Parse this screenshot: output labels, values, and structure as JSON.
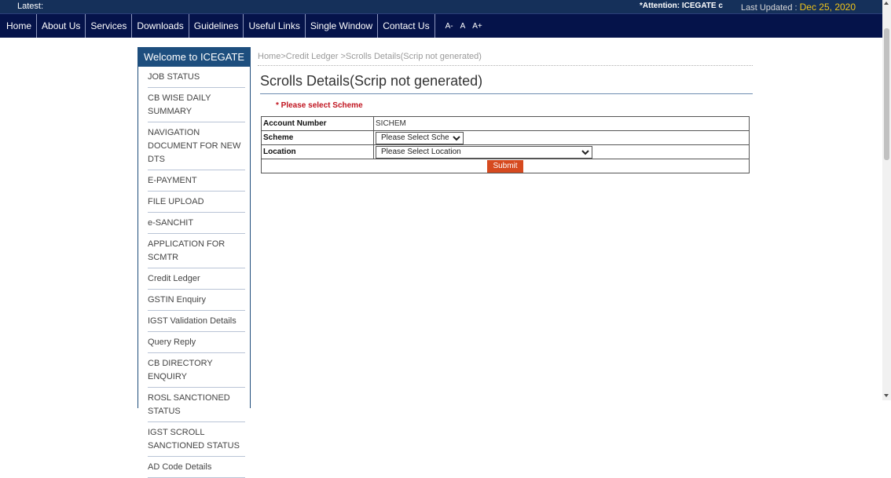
{
  "topbar": {
    "latest_label": "Latest:",
    "attention_text": "*Attention: ICEGATE c",
    "last_updated_label": "Last Updated :",
    "last_updated_date": "Dec 25, 2020"
  },
  "nav": {
    "items": [
      "Home",
      "About Us",
      "Services",
      "Downloads",
      "Guidelines",
      "Useful Links",
      "Single Window",
      "Contact Us"
    ],
    "font_controls": [
      "A-",
      "A",
      "A+"
    ]
  },
  "sidebar": {
    "header": "Welcome to ICEGATE",
    "items": [
      "JOB STATUS",
      "CB WISE DAILY SUMMARY",
      "NAVIGATION DOCUMENT FOR NEW DTS",
      "E-PAYMENT",
      "FILE UPLOAD",
      "e-SANCHIT",
      "APPLICATION FOR SCMTR",
      "Credit Ledger",
      "GSTIN Enquiry",
      "IGST Validation Details",
      "Query Reply",
      "CB DIRECTORY ENQUIRY",
      "ROSL SANCTIONED STATUS",
      "IGST SCROLL SANCTIONED STATUS",
      "AD Code Details"
    ]
  },
  "breadcrumb": {
    "home": "Home",
    "sep1": ">",
    "credit_ledger": "Credit Ledger",
    "sep2": " >",
    "current": "Scrolls Details(Scrip not generated)"
  },
  "page": {
    "title": "Scrolls Details(Scrip not generated)",
    "required_note": "* Please select Scheme"
  },
  "form": {
    "account_label": "Account Number",
    "account_value": "SICHEM",
    "scheme_label": "Scheme",
    "scheme_selected": "Please Select Scheme",
    "location_label": "Location",
    "location_selected": "Please Select Location",
    "submit_label": "Submit"
  },
  "colors": {
    "topbar": "#15305a",
    "navbar": "#05134a",
    "sidebar_header": "#1d4e7e",
    "required": "#c0131e",
    "submit": "#d64a1f",
    "date": "#f0c419"
  }
}
